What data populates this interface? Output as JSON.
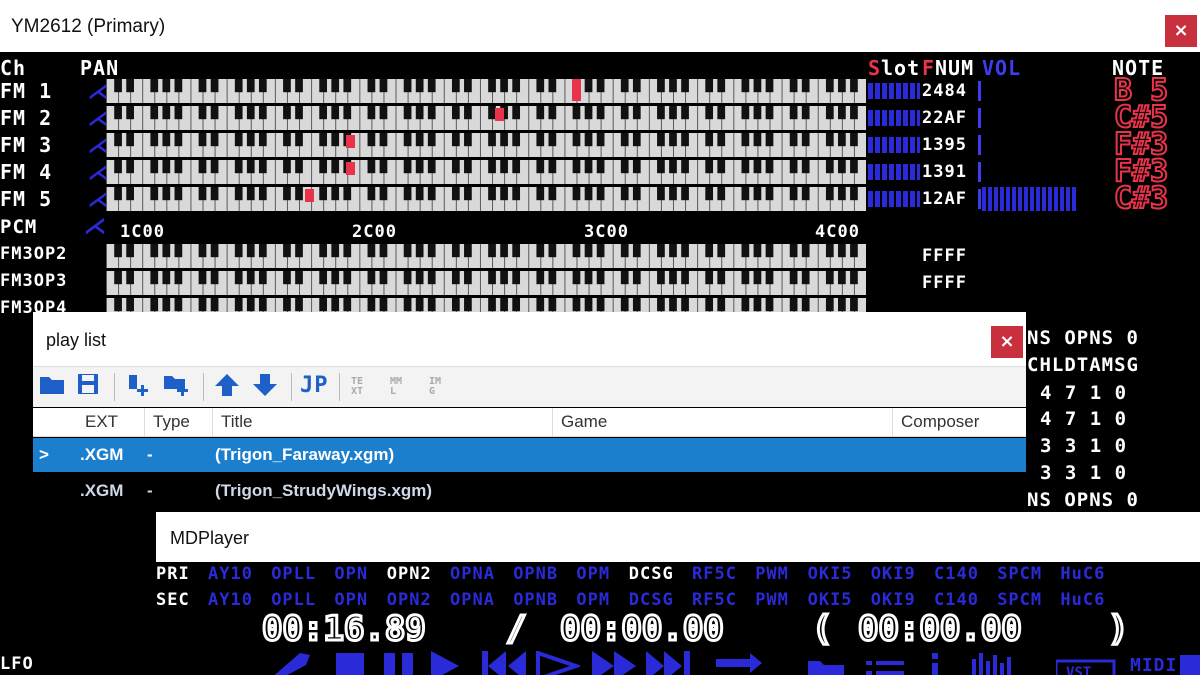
{
  "ym_window": {
    "title": "YM2612 (Primary)",
    "close_glyph": "×",
    "headers": {
      "ch": "Ch",
      "pan": "PAN",
      "slot_s": "S",
      "slot_rest": "lot",
      "fnum_f": "F",
      "fnum_rest": "NUM",
      "vol": "VOL",
      "note": "NOTE"
    },
    "channels": [
      {
        "label": "FM 1",
        "fnum": "2484",
        "note": "B 5"
      },
      {
        "label": "FM 2",
        "fnum": "22AF",
        "note": "C#5"
      },
      {
        "label": "FM 3",
        "fnum": "1395",
        "note": "F#3"
      },
      {
        "label": "FM 4",
        "fnum": "1391",
        "note": "F#3"
      },
      {
        "label": "FM 5",
        "fnum": "12AF",
        "note": "C#3"
      }
    ],
    "pcm": {
      "label": "PCM",
      "ticks": [
        "1C00",
        "2C00",
        "3C00",
        "4C00"
      ]
    },
    "extra_rows": [
      {
        "label": "FM3OP2",
        "fnum": "FFFF"
      },
      {
        "label": "FM3OP3",
        "fnum": "FFFF"
      },
      {
        "label": "FM3OP4",
        "fnum": ""
      }
    ],
    "right_panel": {
      "row1": "NS OPNS 0",
      "row2": "CHLDTAMSG",
      "rows": [
        "4 7 1 0",
        "4 7 1 0",
        "3 3 1 0",
        "3 3 1 0"
      ],
      "row_last": "NS OPNS 0"
    },
    "lfo": "LFO"
  },
  "playlist": {
    "title": "play list",
    "close_glyph": "×",
    "toolbar": {
      "icons": [
        "folder-open-icon",
        "save-icon",
        "add-file-icon",
        "add-folder-icon",
        "move-up-icon",
        "move-down-icon"
      ],
      "jp_label": "JP",
      "disabled": [
        [
          "TE",
          "XT"
        ],
        [
          "MM",
          "L"
        ],
        [
          "IM",
          "G"
        ]
      ]
    },
    "columns": [
      "EXT",
      "Type",
      "Title",
      "Game",
      "Composer"
    ],
    "rows": [
      {
        "marker": ">",
        "ext": ".XGM",
        "type": "-",
        "title": "(Trigon_Faraway.xgm)",
        "selected": true
      },
      {
        "marker": "",
        "ext": ".XGM",
        "type": "-",
        "title": "(Trigon_StrudyWings.xgm)",
        "selected": false
      }
    ],
    "colors": {
      "selected": "#1c7fce",
      "accent": "#1e5fc8"
    }
  },
  "mdplayer": {
    "title": "MDPlayer",
    "pri_label": "PRI",
    "sec_label": "SEC",
    "chips": [
      "AY10",
      "OPLL",
      "OPN",
      "OPN2",
      "OPNA",
      "OPNB",
      "OPM",
      "DCSG",
      "RF5C",
      "PWM",
      "OKI5",
      "OKI9",
      "C140",
      "SPCM",
      "HuC6"
    ],
    "pri_active": [
      "OPN2",
      "DCSG"
    ],
    "time_current": "00:16.89",
    "time_sep": "/",
    "time_total": "00:00.00",
    "time_loop": "00:00.00",
    "paren_open": "(",
    "paren_close": ")",
    "midi_label": "MIDI",
    "colors": {
      "chip_inactive": "#2a2ad8",
      "chip_active": "#ffffff"
    }
  }
}
